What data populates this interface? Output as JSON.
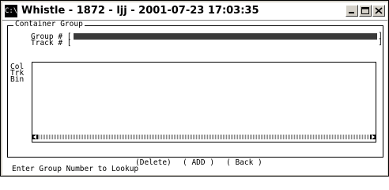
{
  "window": {
    "title": "Whistle - 1872 - ljj - 2001-07-23 17:03:35",
    "icon_label": "C:\\"
  },
  "form": {
    "group_title": "Container Group",
    "group_label": "Group # [",
    "track_label": "Track # [",
    "bracket_close": "]",
    "group_value": "",
    "track_value": ""
  },
  "list": {
    "columns": [
      "Col",
      "Trk",
      "Bin"
    ]
  },
  "actions": {
    "delete": "(Delete)",
    "add": "( ADD )",
    "back": "( Back )"
  },
  "status": "Enter Group Number to Lookup",
  "icons": {
    "minimize": "minimize-icon",
    "maximize": "maximize-icon",
    "close": "close-icon",
    "scroll_left": "scroll-left-arrow-icon",
    "scroll_right": "scroll-right-arrow-icon"
  },
  "colors": {
    "field_fill": "#3a3a3a",
    "frame": "#d4d0c8"
  }
}
